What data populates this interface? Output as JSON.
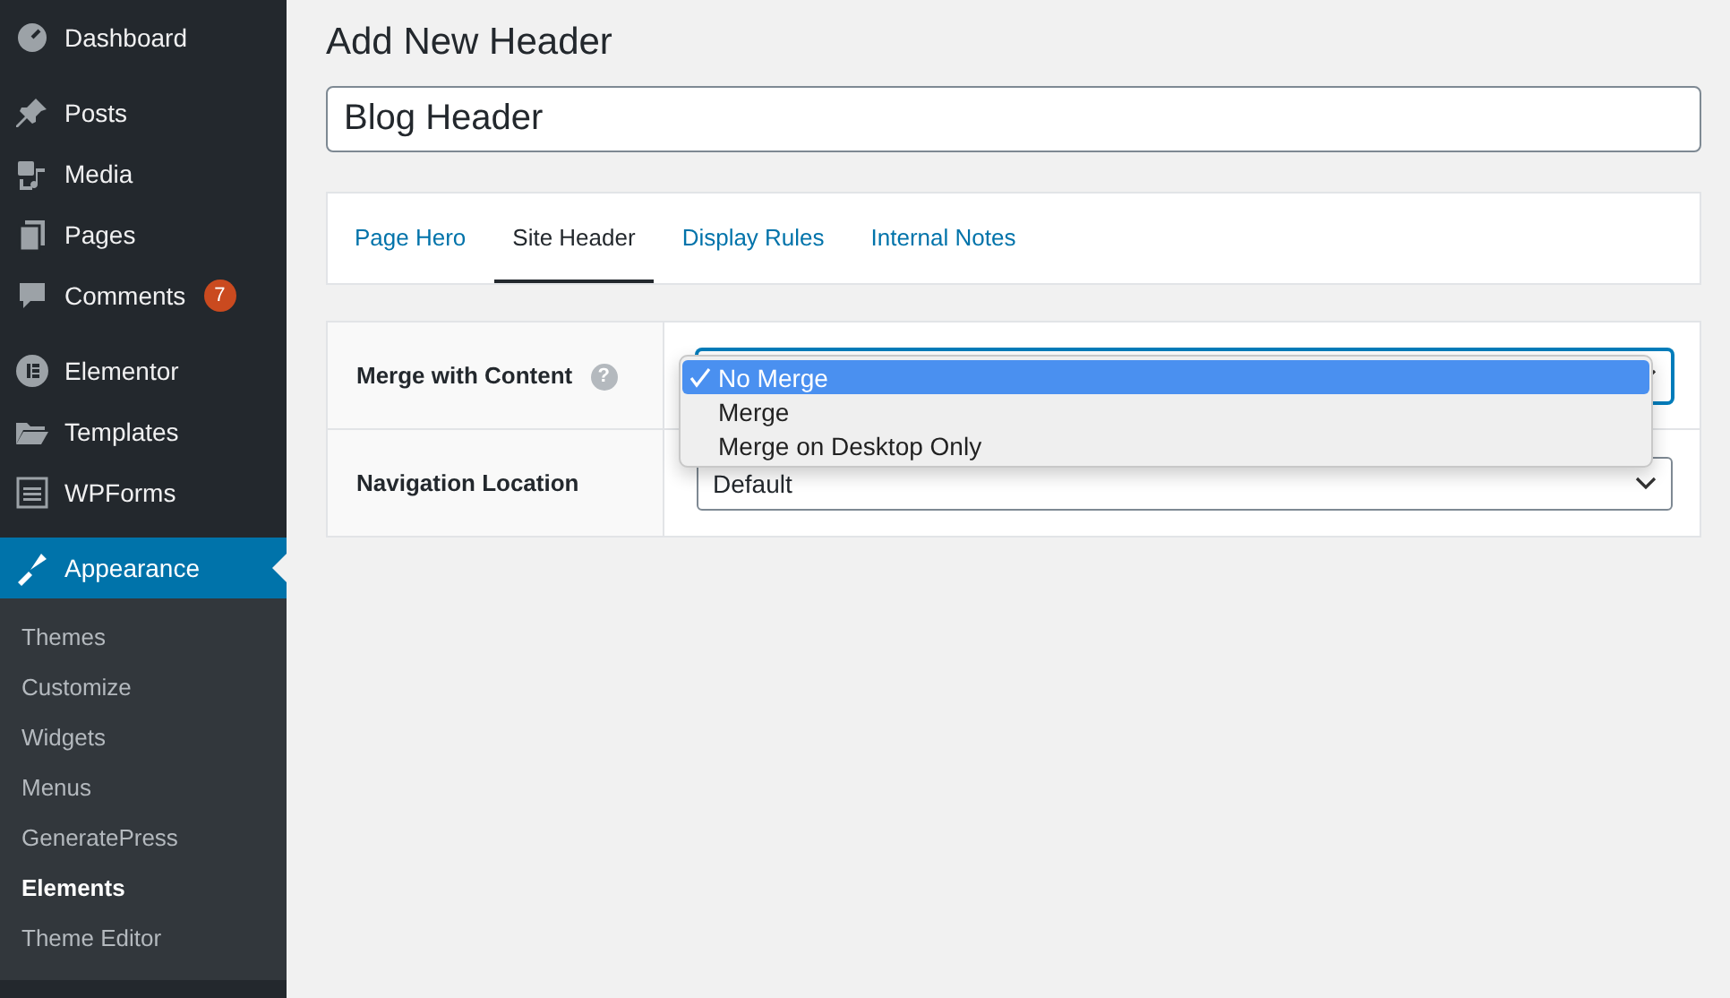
{
  "sidebar": {
    "groups": [
      [
        {
          "label": "Dashboard",
          "selected": false
        }
      ],
      [
        {
          "label": "Posts",
          "selected": false
        },
        {
          "label": "Media",
          "selected": false
        },
        {
          "label": "Pages",
          "selected": false
        },
        {
          "label": "Comments",
          "selected": false,
          "badge": "7"
        }
      ],
      [
        {
          "label": "Elementor",
          "selected": false
        },
        {
          "label": "Templates",
          "selected": false
        },
        {
          "label": "WPForms",
          "selected": false
        }
      ],
      [
        {
          "label": "Appearance",
          "selected": true
        }
      ]
    ],
    "submenu": [
      {
        "label": "Themes",
        "selected": false
      },
      {
        "label": "Customize",
        "selected": false
      },
      {
        "label": "Widgets",
        "selected": false
      },
      {
        "label": "Menus",
        "selected": false
      },
      {
        "label": "GeneratePress",
        "selected": false
      },
      {
        "label": "Elements",
        "selected": true
      },
      {
        "label": "Theme Editor",
        "selected": false
      }
    ]
  },
  "page": {
    "title": "Add New Header",
    "name_field": {
      "value": "Blog Header"
    },
    "tabs": [
      {
        "label": "Page Hero",
        "selected": false
      },
      {
        "label": "Site Header",
        "selected": true
      },
      {
        "label": "Display Rules",
        "selected": false
      },
      {
        "label": "Internal Notes",
        "selected": false
      }
    ],
    "settings": [
      {
        "label": "Merge with Content",
        "help": "?",
        "expanded": true,
        "options": [
          {
            "label": "No Merge",
            "selected": true
          },
          {
            "label": "Merge",
            "selected": false
          },
          {
            "label": "Merge on Desktop Only",
            "selected": false
          }
        ]
      },
      {
        "label": "Navigation Location",
        "value": "Default",
        "expanded": false
      }
    ]
  }
}
